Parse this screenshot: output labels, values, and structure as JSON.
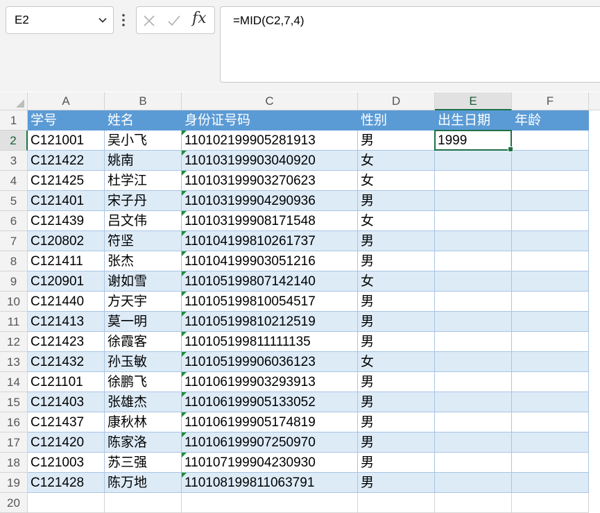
{
  "formula_bar": {
    "name_box": "E2",
    "formula": "=MID(C2,7,4)",
    "fx_label": "fx"
  },
  "columns": [
    "A",
    "B",
    "C",
    "D",
    "E",
    "F"
  ],
  "table_header": [
    "学号",
    "姓名",
    "身份证号码",
    "性别",
    "出生日期",
    "年龄"
  ],
  "rows": [
    {
      "num": "2",
      "id": "C121001",
      "name": "吴小飞",
      "idcard": "110102199905281913",
      "gender": "男",
      "birth": "1999",
      "age": ""
    },
    {
      "num": "3",
      "id": "C121422",
      "name": "姚南",
      "idcard": "110103199903040920",
      "gender": "女",
      "birth": "",
      "age": ""
    },
    {
      "num": "4",
      "id": "C121425",
      "name": "杜学江",
      "idcard": "110103199903270623",
      "gender": "女",
      "birth": "",
      "age": ""
    },
    {
      "num": "5",
      "id": "C121401",
      "name": "宋子丹",
      "idcard": "110103199904290936",
      "gender": "男",
      "birth": "",
      "age": ""
    },
    {
      "num": "6",
      "id": "C121439",
      "name": "吕文伟",
      "idcard": "110103199908171548",
      "gender": "女",
      "birth": "",
      "age": ""
    },
    {
      "num": "7",
      "id": "C120802",
      "name": "符坚",
      "idcard": "110104199810261737",
      "gender": "男",
      "birth": "",
      "age": ""
    },
    {
      "num": "8",
      "id": "C121411",
      "name": "张杰",
      "idcard": "110104199903051216",
      "gender": "男",
      "birth": "",
      "age": ""
    },
    {
      "num": "9",
      "id": "C120901",
      "name": "谢如雪",
      "idcard": "110105199807142140",
      "gender": "女",
      "birth": "",
      "age": ""
    },
    {
      "num": "10",
      "id": "C121440",
      "name": "方天宇",
      "idcard": "110105199810054517",
      "gender": "男",
      "birth": "",
      "age": ""
    },
    {
      "num": "11",
      "id": "C121413",
      "name": "莫一明",
      "idcard": "110105199810212519",
      "gender": "男",
      "birth": "",
      "age": ""
    },
    {
      "num": "12",
      "id": "C121423",
      "name": "徐霞客",
      "idcard": "110105199811111135",
      "gender": "男",
      "birth": "",
      "age": ""
    },
    {
      "num": "13",
      "id": "C121432",
      "name": "孙玉敏",
      "idcard": "110105199906036123",
      "gender": "女",
      "birth": "",
      "age": ""
    },
    {
      "num": "14",
      "id": "C121101",
      "name": "徐鹏飞",
      "idcard": "110106199903293913",
      "gender": "男",
      "birth": "",
      "age": ""
    },
    {
      "num": "15",
      "id": "C121403",
      "name": "张雄杰",
      "idcard": "110106199905133052",
      "gender": "男",
      "birth": "",
      "age": ""
    },
    {
      "num": "16",
      "id": "C121437",
      "name": "康秋林",
      "idcard": "110106199905174819",
      "gender": "男",
      "birth": "",
      "age": ""
    },
    {
      "num": "17",
      "id": "C121420",
      "name": "陈家洛",
      "idcard": "110106199907250970",
      "gender": "男",
      "birth": "",
      "age": ""
    },
    {
      "num": "18",
      "id": "C121003",
      "name": "苏三强",
      "idcard": "110107199904230930",
      "gender": "男",
      "birth": "",
      "age": ""
    },
    {
      "num": "19",
      "id": "C121428",
      "name": "陈万地",
      "idcard": "110108199811063791",
      "gender": "男",
      "birth": "",
      "age": ""
    }
  ],
  "extra_row_number": "20",
  "colors": {
    "header_fill": "#5b9bd5",
    "band_fill": "#ddebf7",
    "selection": "#1e7145"
  }
}
